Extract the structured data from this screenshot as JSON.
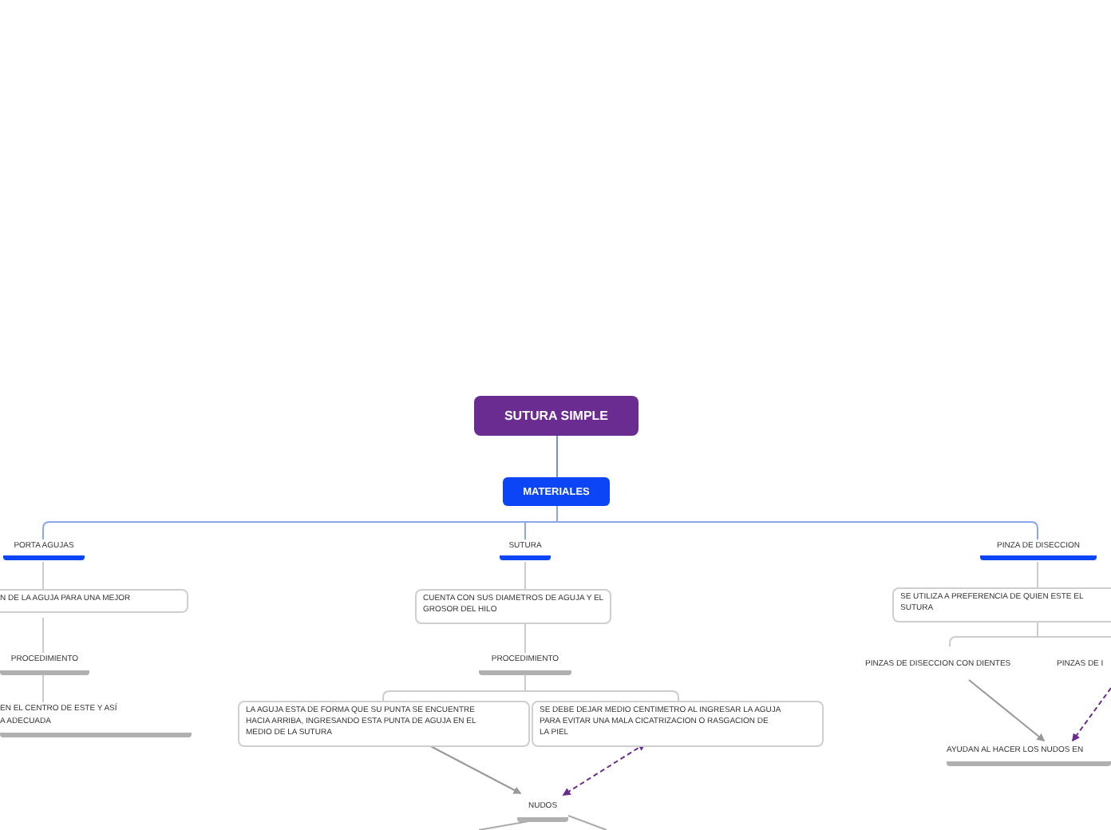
{
  "nodes": [
    {
      "kind": "central",
      "text": "SUTURA SIMPLE"
    },
    {
      "kind": "main",
      "text": "MATERIALES"
    },
    {
      "kind": "topic",
      "text": "PORTA AGUJAS"
    },
    {
      "kind": "topic",
      "text": "SUTURA"
    },
    {
      "kind": "topic",
      "text": "PINZA DE DISECCION"
    },
    {
      "kind": "note",
      "text": "N DE LA AGUJA PARA UNA MEJOR"
    },
    {
      "kind": "subtopic",
      "text": "PROCEDIMIENTO"
    },
    {
      "kind": "subtopic",
      "text": "EN EL CENTRO DE ESTE Y ASÍ\nA ADECUADA"
    },
    {
      "kind": "note",
      "text": "CUENTA CON SUS DIAMETROS DE AGUJA Y EL\nGROSOR DEL HILO"
    },
    {
      "kind": "subtopic",
      "text": "PROCEDIMIENTO"
    },
    {
      "kind": "note",
      "text": "LA AGUJA ESTA DE FORMA QUE SU PUNTA SE ENCUENTRE\nHACIA ARRIBA, INGRESANDO ESTA PUNTA DE AGUJA EN EL\nMEDIO DE LA SUTURA"
    },
    {
      "kind": "note",
      "text": "SE DEBE DEJAR MEDIO CENTIMETRO AL INGRESAR LA AGUJA\nPARA EVITAR UNA MALA CICATRIZACION O RASGACION DE\nLA PIEL"
    },
    {
      "kind": "subtopic",
      "text": "NUDOS"
    },
    {
      "kind": "note",
      "text": "SE UTILIZA A PREFERENCIA DE QUIEN ESTE EL\nSUTURA"
    },
    {
      "kind": "label",
      "text": "PINZAS DE DISECCION CON DIENTES"
    },
    {
      "kind": "label",
      "text": "PINZAS DE I"
    },
    {
      "kind": "subtopic",
      "text": "AYUDAN AL HACER LOS NUDOS EN"
    }
  ]
}
